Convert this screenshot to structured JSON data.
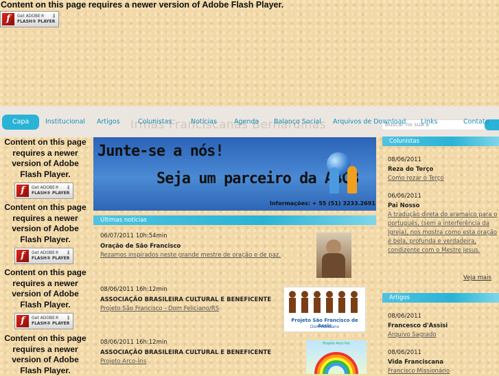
{
  "flash": {
    "message": "Content on this page requires a newer version of Adobe Flash Player.",
    "badge_line1": "Get ADOBE®",
    "badge_line2": "FLASH® PLAYER",
    "badge_logo": "f"
  },
  "header": {
    "watermark": "Irmãs Franciscanas Bernardinas",
    "search_placeholder": "Buscar no sua a"
  },
  "menu": {
    "items": [
      {
        "label": "Capa"
      },
      {
        "label": "Institucional"
      },
      {
        "label": "Artigos"
      },
      {
        "label": "Colunistas"
      },
      {
        "label": "Notícias"
      },
      {
        "label": "Agenda"
      },
      {
        "label": "Balanço Social"
      },
      {
        "label": "Arquivos de Download"
      },
      {
        "label": "Links"
      },
      {
        "label": "Contato"
      }
    ]
  },
  "banner": {
    "line1": "Junte-se a nós!",
    "line2": "Seja um parceiro da ABCB",
    "line3": "Informações: + 55 (51) 3233.2691"
  },
  "news": {
    "heading": "Últimas notícias",
    "items": [
      {
        "date": "06/07/2011 10h:54min",
        "title": "Oração de São Francisco",
        "desc": "Rezamos inspirados neste grande mestre de oração e de paz."
      },
      {
        "date": "08/06/2011 16h:12min",
        "title": "ASSOCIAÇÃO BRASILEIRA CULTURAL E BENEFICENTE",
        "desc": "Projeto São Francisco - Dom Feliciano/RS",
        "thumb_caption": "Projeto São Francisco de Assis",
        "thumb_sub": "Dom Feliciano"
      },
      {
        "date": "08/06/2011 16h:12min",
        "title": "ASSOCIAÇÃO BRASILEIRA CULTURAL E BENEFICENTE",
        "desc": "Projeto Arco-Íris",
        "thumb_caption": "Projeto Arco-Íris"
      }
    ]
  },
  "columnists": {
    "heading": "Colunistas",
    "items": [
      {
        "date": "08/06/2011",
        "title": "Reza do Terço",
        "desc": "Como rezar o Terço"
      },
      {
        "date": "06/06/2011",
        "title": "Pai Nosso",
        "desc": "A tradução direta do aramaico para o português, (sem a interferência da Igreja), nos mostra como esta oração é bela, profunda e verdadeira, condizente com o Mestre Jesus."
      }
    ],
    "see_more": "Veja mais"
  },
  "articles": {
    "heading": "Artigos",
    "items": [
      {
        "date": "08/06/2011",
        "title": "Francesco d'Assisi",
        "desc": "Arquivo Sagrado"
      },
      {
        "date": "08/06/2011",
        "title": "Vida Franciscana",
        "desc": "Francisco Missionário"
      }
    ]
  },
  "colors": {
    "accent": "#2ab3d6",
    "background": "#f2d9a8",
    "link": "#1a8fb8"
  }
}
